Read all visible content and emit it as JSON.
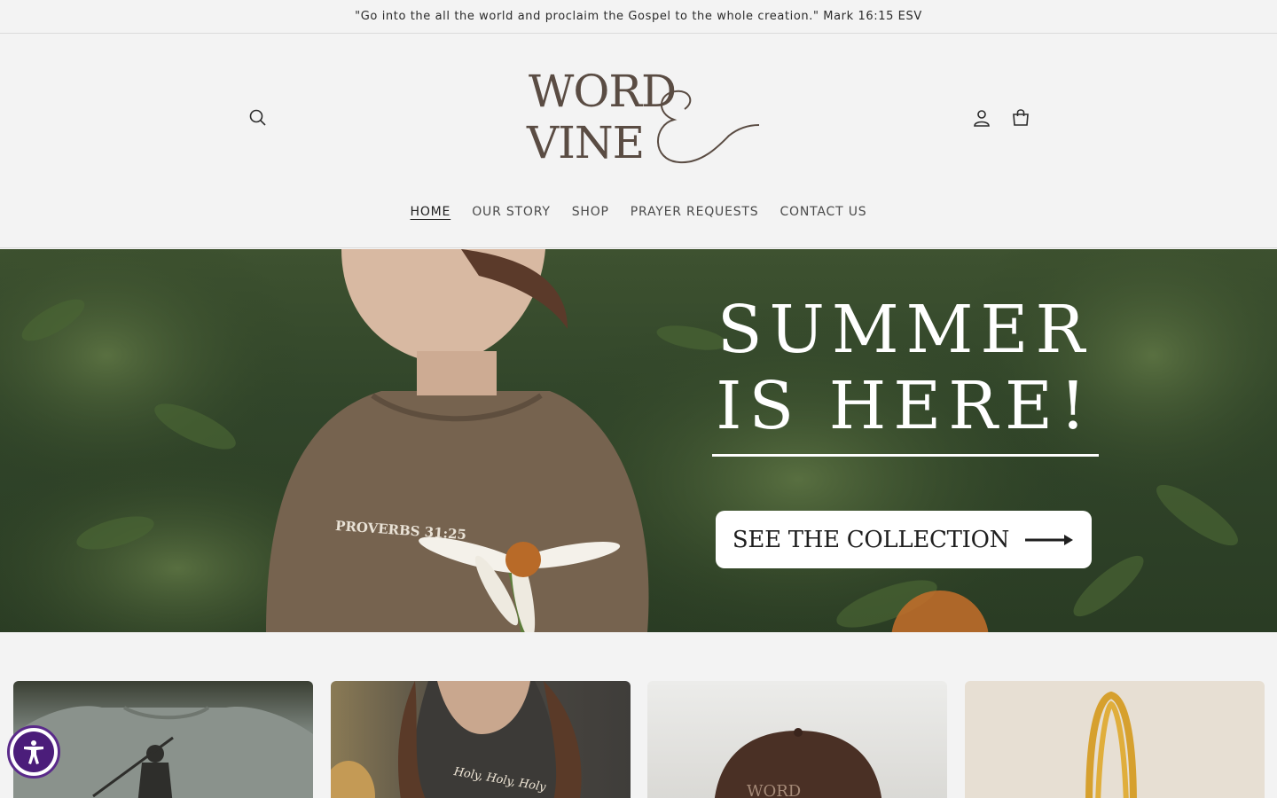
{
  "announcement": {
    "text": "\"Go into the all the world and proclaim the Gospel to the whole creation.\" Mark 16:15 ESV"
  },
  "header": {
    "logo_line1": "WORD",
    "logo_line2": "VINE",
    "icons": {
      "search": "search-icon",
      "account": "account-icon",
      "cart": "cart-icon"
    }
  },
  "nav": {
    "items": [
      {
        "label": "HOME",
        "active": true
      },
      {
        "label": "OUR STORY",
        "active": false
      },
      {
        "label": "SHOP",
        "active": false
      },
      {
        "label": "PRAYER REQUESTS",
        "active": false
      },
      {
        "label": "CONTACT US",
        "active": false
      }
    ]
  },
  "hero": {
    "title_line1": "SUMMER",
    "title_line2": "IS HERE!",
    "button_label": "SEE THE COLLECTION",
    "shirt_text": "PROVERBS 31:25"
  },
  "cards": {
    "card2_text": "Holy, Holy, Holy",
    "card3_text": "WORD"
  },
  "colors": {
    "background": "#f3f3f3",
    "logo": "#5a4c43",
    "accessibility": "#4b1d7a"
  }
}
